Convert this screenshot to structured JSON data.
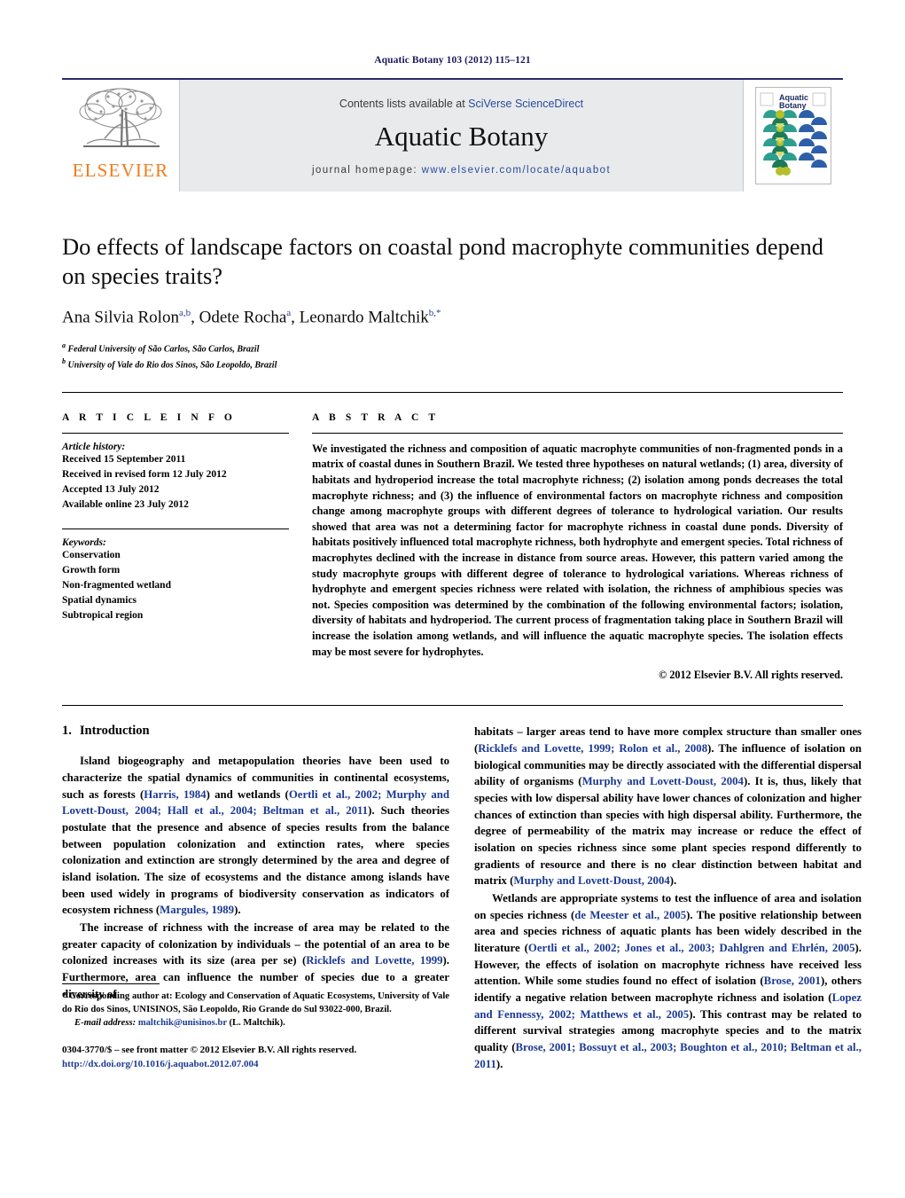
{
  "running_head": "Aquatic Botany 103 (2012) 115–121",
  "masthead": {
    "publisher_logo_label": "ELSEVIER",
    "contents_prefix": "Contents lists available at",
    "contents_link": "SciVerse ScienceDirect",
    "journal_title": "Aquatic Botany",
    "homepage_prefix": "journal homepage:",
    "homepage_url": "www.elsevier.com/locate/aquabot",
    "cover_title_line1": "Aquatic",
    "cover_title_line2": "Botany"
  },
  "article": {
    "title": "Do effects of landscape factors on coastal pond macrophyte communities depend on species traits?",
    "authors_plain": "Ana Silvia Rolon",
    "author2": ", Odete Rocha",
    "author3": ", Leonardo Maltchik",
    "sup1": "a,b",
    "sup2": "a",
    "sup3": "b,*",
    "affiliation_a_mark": "a",
    "affiliation_a": "Federal University of São Carlos, São Carlos, Brazil",
    "affiliation_b_mark": "b",
    "affiliation_b": "University of Vale do Rio dos Sinos, São Leopoldo, Brazil"
  },
  "article_info": {
    "heading": "A R T I C L E   I N F O",
    "history_label": "Article history:",
    "history": [
      "Received 15 September 2011",
      "Received in revised form 12 July 2012",
      "Accepted 13 July 2012",
      "Available online 23 July 2012"
    ],
    "keywords_label": "Keywords:",
    "keywords": [
      "Conservation",
      "Growth form",
      "Non-fragmented wetland",
      "Spatial dynamics",
      "Subtropical region"
    ]
  },
  "abstract": {
    "heading": "A B S T R A C T",
    "text": "We investigated the richness and composition of aquatic macrophyte communities of non-fragmented ponds in a matrix of coastal dunes in Southern Brazil. We tested three hypotheses on natural wetlands; (1) area, diversity of habitats and hydroperiod increase the total macrophyte richness; (2) isolation among ponds decreases the total macrophyte richness; and (3) the influence of environmental factors on macrophyte richness and composition change among macrophyte groups with different degrees of tolerance to hydrological variation. Our results showed that area was not a determining factor for macrophyte richness in coastal dune ponds. Diversity of habitats positively influenced total macrophyte richness, both hydrophyte and emergent species. Total richness of macrophytes declined with the increase in distance from source areas. However, this pattern varied among the study macrophyte groups with different degree of tolerance to hydrological variations. Whereas richness of hydrophyte and emergent species richness were related with isolation, the richness of amphibious species was not. Species composition was determined by the combination of the following environmental factors; isolation, diversity of habitats and hydroperiod. The current process of fragmentation taking place in Southern Brazil will increase the isolation among wetlands, and will influence the aquatic macrophyte species. The isolation effects may be most severe for hydrophytes.",
    "copyright": "© 2012 Elsevier B.V. All rights reserved."
  },
  "introduction": {
    "number": "1.",
    "title": "Introduction",
    "left_p1_a": "Island biogeography and metapopulation theories have been used to characterize the spatial dynamics of communities in continental ecosystems, such as forests (",
    "left_p1_cite1": "Harris, 1984",
    "left_p1_b": ") and wetlands (",
    "left_p1_cite2": "Oertli et al., 2002; Murphy and Lovett-Doust, 2004; Hall et al., 2004; Beltman et al., 2011",
    "left_p1_c": "). Such theories postulate that the presence and absence of species results from the balance between population colonization and extinction rates, where species colonization and extinction are strongly determined by the area and degree of island isolation. The size of ecosystems and the distance among islands have been used widely in programs of biodiversity conservation as indicators of ecosystem richness (",
    "left_p1_cite3": "Margules, 1989",
    "left_p1_d": ").",
    "left_p2_a": "The increase of richness with the increase of area may be related to the greater capacity of colonization by individuals – the potential of an area to be colonized increases with its size (area per se) (",
    "left_p2_cite1": "Ricklefs and Lovette, 1999",
    "left_p2_b": "). Furthermore, area can influence the number of species due to a greater diversity of",
    "right_p1_a": "habitats – larger areas tend to have more complex structure than smaller ones (",
    "right_p1_cite1": "Ricklefs and Lovette, 1999; Rolon et al., 2008",
    "right_p1_b": "). The influence of isolation on biological communities may be directly associated with the differential dispersal ability of organisms (",
    "right_p1_cite2": "Murphy and Lovett-Doust, 2004",
    "right_p1_c": "). It is, thus, likely that species with low dispersal ability have lower chances of colonization and higher chances of extinction than species with high dispersal ability. Furthermore, the degree of permeability of the matrix may increase or reduce the effect of isolation on species richness since some plant species respond differently to gradients of resource and there is no clear distinction between habitat and matrix (",
    "right_p1_cite3": "Murphy and Lovett-Doust, 2004",
    "right_p1_d": ").",
    "right_p2_a": "Wetlands are appropriate systems to test the influence of area and isolation on species richness (",
    "right_p2_cite1": "de Meester et al., 2005",
    "right_p2_b": "). The positive relationship between area and species richness of aquatic plants has been widely described in the literature (",
    "right_p2_cite2": "Oertli et al., 2002; Jones et al., 2003; Dahlgren and Ehrlén, 2005",
    "right_p2_c": "). However, the effects of isolation on macrophyte richness have received less attention. While some studies found no effect of isolation (",
    "right_p2_cite3": "Brose, 2001",
    "right_p2_d": "), others identify a negative relation between macrophyte richness and isolation (",
    "right_p2_cite4": "Lopez and Fennessy, 2002; Matthews et al., 2005",
    "right_p2_e": "). This contrast may be related to different survival strategies among macrophyte species and to the matrix quality (",
    "right_p2_cite5": "Brose, 2001; Bossuyt et al., 2003; Boughton et al., 2010; Beltman et al., 2011",
    "right_p2_f": ")."
  },
  "footer": {
    "corresponding_mark": "*",
    "corresponding_text": " Corresponding author at: Ecology and Conservation of Aquatic Ecosystems, University of Vale do Rio dos Sinos, UNISINOS, São Leopoldo, Rio Grande do Sul 93022-000, Brazil.",
    "email_label": "E-mail address:",
    "email": "maltchik@unisinos.br",
    "email_suffix": " (L. Maltchik).",
    "issn_line": "0304-3770/$ – see front matter © 2012 Elsevier B.V. All rights reserved.",
    "doi": "http://dx.doi.org/10.1016/j.aquabot.2012.07.004"
  },
  "colors": {
    "link_blue": "#1b3a93",
    "header_navy": "#1a1a5e",
    "elsevier_orange": "#f07c1a",
    "masthead_gray": "#e8eaec"
  }
}
